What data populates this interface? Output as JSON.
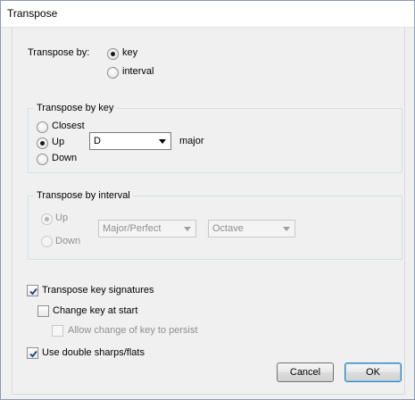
{
  "window": {
    "title": "Transpose"
  },
  "transpose_by": {
    "label": "Transpose by:",
    "options": [
      {
        "label": "key",
        "selected": true
      },
      {
        "label": "interval",
        "selected": false
      }
    ]
  },
  "by_key": {
    "title": "Transpose by key",
    "options": [
      {
        "label": "Closest",
        "selected": false
      },
      {
        "label": "Up",
        "selected": true
      },
      {
        "label": "Down",
        "selected": false
      }
    ],
    "key_select": "D",
    "mode_label": "major"
  },
  "by_interval": {
    "title": "Transpose by interval",
    "options": [
      {
        "label": "Up",
        "selected": true
      },
      {
        "label": "Down",
        "selected": false
      }
    ],
    "quality_select": "Major/Perfect",
    "interval_select": "Octave"
  },
  "checkboxes": {
    "transpose_key_signatures": {
      "label": "Transpose key signatures",
      "checked": true
    },
    "change_key_at_start": {
      "label": "Change key at start",
      "checked": false
    },
    "allow_change_persist": {
      "label": "Allow change of key to persist",
      "checked": false
    },
    "use_double_sharps": {
      "label": "Use double sharps/flats",
      "checked": true
    }
  },
  "buttons": {
    "cancel": "Cancel",
    "ok": "OK"
  }
}
